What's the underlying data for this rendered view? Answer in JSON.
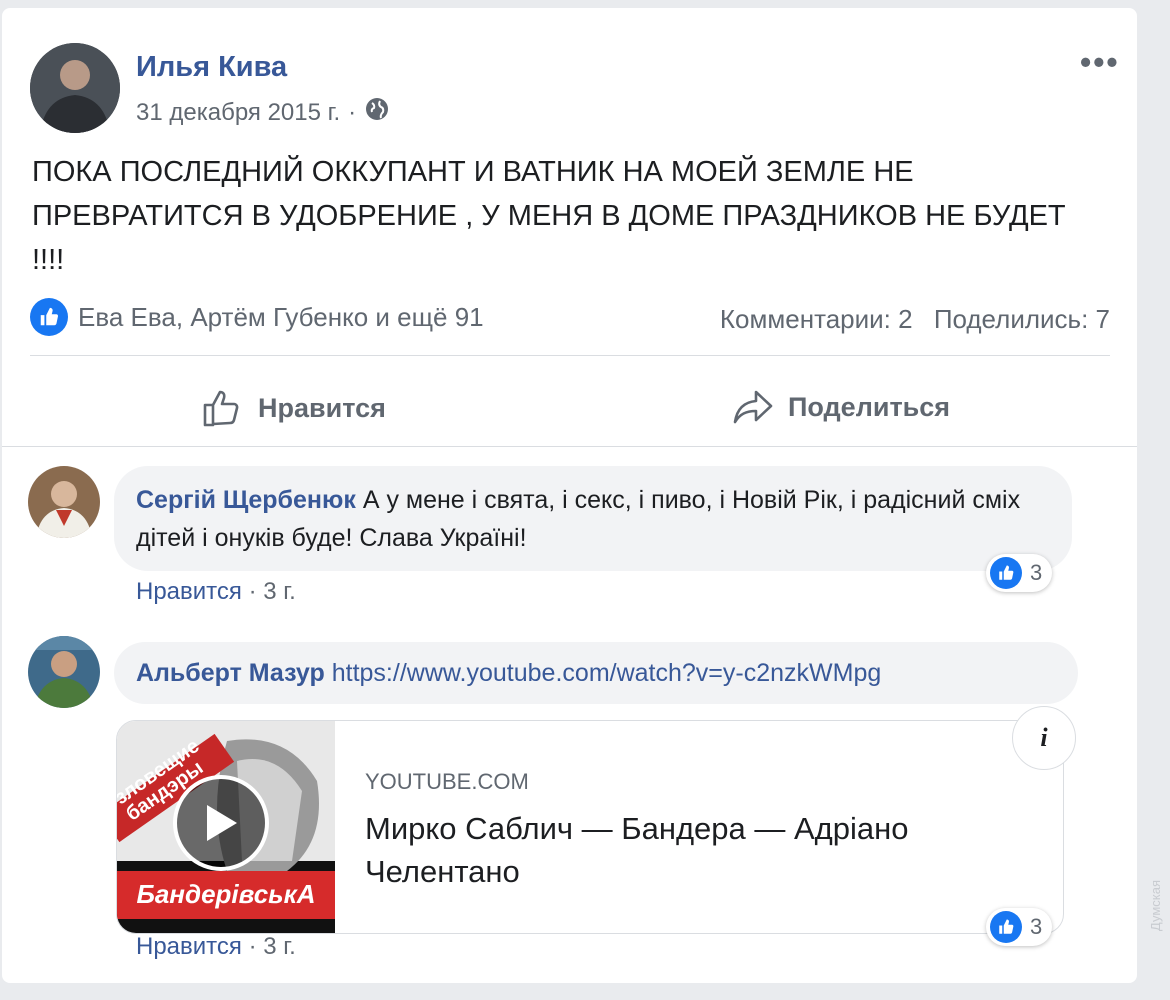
{
  "post": {
    "author": "Илья Кива",
    "date": "31 декабря 2015 г.",
    "separator": "·",
    "text": "ПОКА ПОСЛЕДНИЙ ОККУПАНТ И ВАТНИК НА МОЕЙ ЗЕМЛЕ НЕ ПРЕВРАТИТСЯ В УДОБРЕНИЕ , У МЕНЯ В ДОМЕ ПРАЗДНИКОВ НЕ БУДЕТ !!!!",
    "reactions_text": "Ева Ева, Артём Губенко и ещё 91",
    "comments_count": "Комментарии: 2",
    "shares_count": "Поделились: 7",
    "like_label": "Нравится",
    "share_label": "Поделиться"
  },
  "comments": [
    {
      "author": "Сергій Щербенюк",
      "text": "А у мене і свята, і секс, і пиво, і Новій Рік, і радісний сміх дітей і онуків буде! Слава Україні!",
      "like_label": "Нравится",
      "separator": "·",
      "time": "3 г.",
      "reactions": "3"
    },
    {
      "author": "Альберт Мазур",
      "link": "https://www.youtube.com/watch?v=y-c2nzkWMpg",
      "preview_domain": "YOUTUBE.COM",
      "preview_title": "Мирко Саблич — Бандера — Адріано Челентано",
      "thumb_top_text": "зловещие бандэры",
      "thumb_bottom_text": "БандерівськА",
      "info_icon": "i",
      "like_label": "Нравится",
      "separator": "·",
      "time": "3 г.",
      "reactions": "3"
    }
  ],
  "watermark": "Думская",
  "colors": {
    "brand_blue": "#1877f2",
    "name_blue": "#385898",
    "secondary_text": "#606770"
  }
}
